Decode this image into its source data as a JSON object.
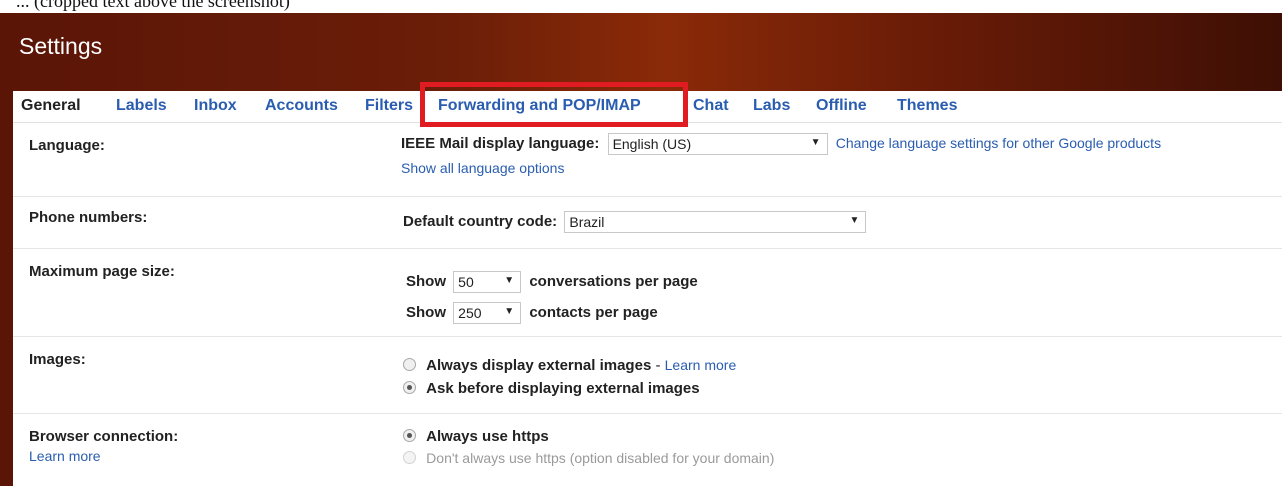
{
  "caption": "... (cropped text above the screenshot)",
  "header": {
    "title": "Settings"
  },
  "tabs": [
    {
      "label": "General",
      "active": true
    },
    {
      "label": "Labels"
    },
    {
      "label": "Inbox"
    },
    {
      "label": "Accounts"
    },
    {
      "label": "Filters"
    },
    {
      "label": "Forwarding and POP/IMAP",
      "highlighted": true
    },
    {
      "label": "Chat"
    },
    {
      "label": "Labs"
    },
    {
      "label": "Offline"
    },
    {
      "label": "Themes"
    }
  ],
  "colors": {
    "accent_link": "#2a5db0",
    "highlight_border": "#e01b22",
    "header_bg": "#6b1e08"
  },
  "language": {
    "label": "Language:",
    "display_label": "IEEE Mail display language:",
    "selected": "English (US)",
    "change_link": "Change language settings for other Google products",
    "show_all_link": "Show all language options"
  },
  "phone": {
    "label": "Phone numbers:",
    "country_label": "Default country code:",
    "selected": "Brazil"
  },
  "page_size": {
    "label": "Maximum page size:",
    "show_label": "Show",
    "conversations_value": "50",
    "conversations_suffix": "conversations per page",
    "contacts_value": "250",
    "contacts_suffix": "contacts per page"
  },
  "images": {
    "label": "Images:",
    "option_always": "Always display external images",
    "dash": " - ",
    "learn_more": "Learn more",
    "option_ask": "Ask before displaying external images",
    "selected": "ask"
  },
  "browser": {
    "label": "Browser connection:",
    "learn_more": "Learn more",
    "option_https": "Always use https",
    "option_no_https": "Don't always use https (option disabled for your domain)",
    "selected": "https"
  }
}
